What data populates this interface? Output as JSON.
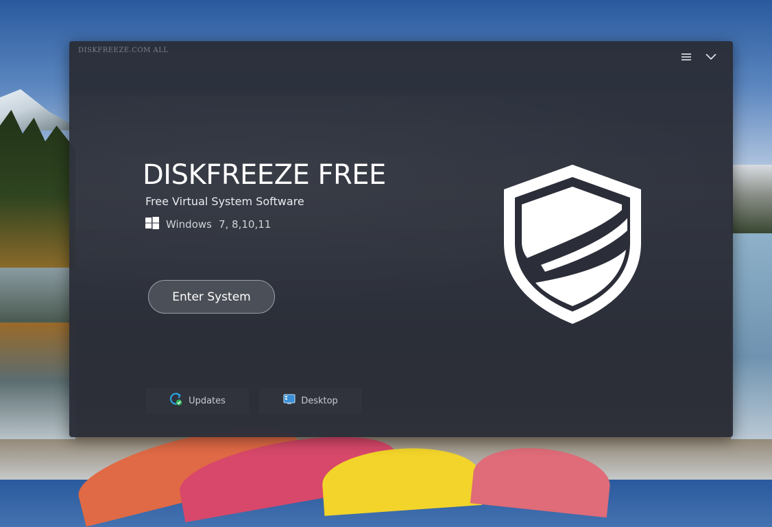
{
  "watermark": "DISKFREEZE.COM ALL",
  "window_controls": {
    "menu_icon": "hamburger-menu-icon",
    "collapse_icon": "chevron-down-icon"
  },
  "app": {
    "title": "DISKFREEZE FREE",
    "subtitle": "Free Virtual System Software",
    "os_label": "Windows",
    "os_versions": "7, 8,10,11",
    "os_icon": "windows-logo-icon"
  },
  "primary_action": {
    "label": "Enter System"
  },
  "bottom_actions": [
    {
      "label": "Updates",
      "icon": "refresh-check-icon"
    },
    {
      "label": "Desktop",
      "icon": "desktop-icon"
    }
  ],
  "logo": {
    "icon": "shield-icon"
  },
  "colors": {
    "panel_bg": "#2b2e38",
    "accent_blue": "#2aa3e0",
    "accent_green": "#2fb35a",
    "text_primary": "#ffffff"
  }
}
